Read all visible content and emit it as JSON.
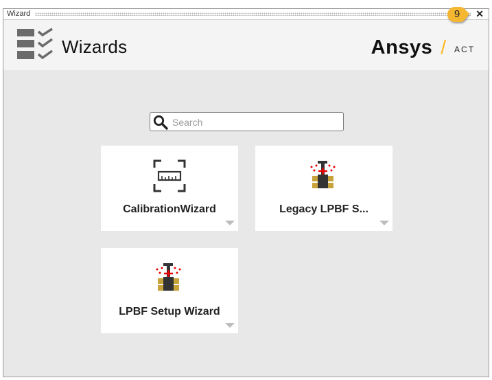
{
  "window": {
    "title": "Wizard",
    "close_glyph": "✕"
  },
  "header": {
    "heading": "Wizards",
    "brand": "Ansys",
    "brand_suffix": "ACT",
    "slash": "/"
  },
  "search": {
    "placeholder": "Search"
  },
  "tiles": [
    {
      "label": "CalibrationWizard",
      "icon": "calibration-ruler-icon"
    },
    {
      "label": "Legacy LPBF S...",
      "icon": "lpbf-printer-icon"
    },
    {
      "label": "LPBF Setup Wizard",
      "icon": "lpbf-printer-icon"
    }
  ],
  "callout": {
    "number": "9"
  },
  "colors": {
    "brand_accent": "#ffb71b",
    "callout": "#f5b731",
    "tile_bg": "#ffffff",
    "panel_bg": "#e8e8e8"
  }
}
